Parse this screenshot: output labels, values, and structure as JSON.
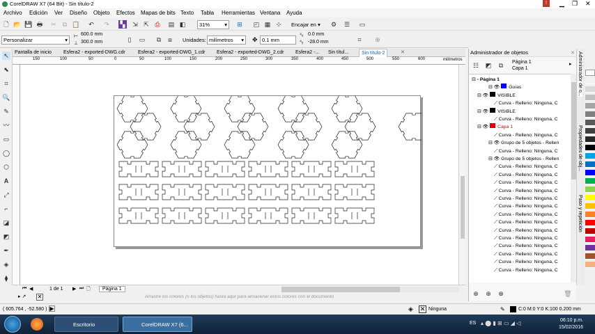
{
  "window": {
    "title": "CorelDRAW X7 (64 Bit) - Sin título-2"
  },
  "menu": [
    "Archivo",
    "Edición",
    "Ver",
    "Diseño",
    "Objeto",
    "Efectos",
    "Mapas de bits",
    "Texto",
    "Tabla",
    "Herramientas",
    "Ventana",
    "Ayuda"
  ],
  "toolbar": {
    "zoom": "31%",
    "snap": "Encajar en"
  },
  "propbar": {
    "preset": "Personalizar",
    "width": "600.0 mm",
    "height": "300.0 mm",
    "units_label": "Unidades:",
    "units": "milímetros",
    "nudge": "0.1 mm",
    "dup_x": "0.0 mm",
    "dup_y": "-28.0 mm"
  },
  "tabs": [
    "Pantalla de inicio",
    "Esfera2 - exported-DWG.cdr",
    "Esfera2 - exported-DWG_1.cdr",
    "Esfera2 - exported-DWG_2.cdr",
    "Esfera2 -...",
    "Sin títul...",
    "Sin título-2"
  ],
  "ruler": {
    "labels": [
      "150",
      "100",
      "50",
      "0",
      "50",
      "100",
      "150",
      "200",
      "250",
      "300",
      "350",
      "400",
      "450",
      "500",
      "550",
      "600"
    ],
    "units": "milímetros"
  },
  "page_nav": {
    "page_count": "1 de 1",
    "page_tab": "Página 1"
  },
  "palette": {
    "hint": "Arrastre los colores (o los objetos) hasta aquí para almacenar estos colores con el documento"
  },
  "dock": {
    "title": "Administrador de objetos",
    "page": "Página 1",
    "layer": "Capa 1",
    "tree": [
      {
        "text": "Página 1",
        "indent": 0,
        "bold": true
      },
      {
        "text": "Guías",
        "indent": 3,
        "color": "#0000ff",
        "italic": true
      },
      {
        "text": "VISIBLE",
        "indent": 1,
        "color": "#000"
      },
      {
        "text": "Curva - Relleno: Ninguna, C",
        "indent": 4
      },
      {
        "text": "VISIBLE",
        "indent": 1,
        "color": "#000"
      },
      {
        "text": "Curva - Relleno: Ninguna, C",
        "indent": 4
      },
      {
        "text": "Capa 1",
        "indent": 1,
        "color": "#e00000",
        "red": true
      },
      {
        "text": "Curva - Relleno: Ninguna, C",
        "indent": 4
      },
      {
        "text": "Grupo de 5 objetos - Rellen",
        "indent": 3
      },
      {
        "text": "Curva - Relleno: Ninguna, C",
        "indent": 4
      },
      {
        "text": "Grupo de 5 objetos - Rellen",
        "indent": 3
      },
      {
        "text": "Curva - Relleno: Ninguna, C",
        "indent": 4
      },
      {
        "text": "Curva - Relleno: Ninguna, C",
        "indent": 4
      },
      {
        "text": "Curva - Relleno: Ninguna, C",
        "indent": 4
      },
      {
        "text": "Curva - Relleno: Ninguna, C",
        "indent": 4
      },
      {
        "text": "Curva - Relleno: Ninguna, C",
        "indent": 4
      },
      {
        "text": "Curva - Relleno: Ninguna, C",
        "indent": 4
      },
      {
        "text": "Curva - Relleno: Ninguna, C",
        "indent": 4
      },
      {
        "text": "Curva - Relleno: Ninguna, C",
        "indent": 4
      },
      {
        "text": "Curva - Relleno: Ninguna, C",
        "indent": 4
      },
      {
        "text": "Curva - Relleno: Ninguna, C",
        "indent": 4
      },
      {
        "text": "Curva - Relleno: Ninguna, C",
        "indent": 4
      },
      {
        "text": "Curva - Relleno: Ninguna, C",
        "indent": 4
      },
      {
        "text": "Curva - Relleno: Ninguna, C",
        "indent": 4
      },
      {
        "text": "Curva - Relleno: Ninguna, C",
        "indent": 4
      }
    ]
  },
  "side_tabs": [
    "Administrador de o...",
    "Propiedades de obj...",
    "Paso y repetición"
  ],
  "status": {
    "coords": "( 605.764 , -52.580 )",
    "fill": "Ninguna",
    "outline": "C:0 M:0 Y:0 K:100  0.200 mm"
  },
  "taskbar": {
    "btn1": "Escritorio",
    "btn2": "CorelDRAW X7 (6...",
    "lang": "ES",
    "time": "06:10 p.m.",
    "date": "15/02/2016"
  },
  "colors": [
    "#ffffff",
    "#f2f2f2",
    "#d9d9d9",
    "#bfbfbf",
    "#a6a6a6",
    "#808080",
    "#595959",
    "#404040",
    "#262626",
    "#000000",
    "#00a2e8",
    "#0070c0",
    "#0000ff",
    "#00b050",
    "#92d050",
    "#ffff00",
    "#ffc000",
    "#ff7f27",
    "#ff0000",
    "#c00000",
    "#e91e63",
    "#7030a0",
    "#a0522d",
    "#f4b183"
  ]
}
